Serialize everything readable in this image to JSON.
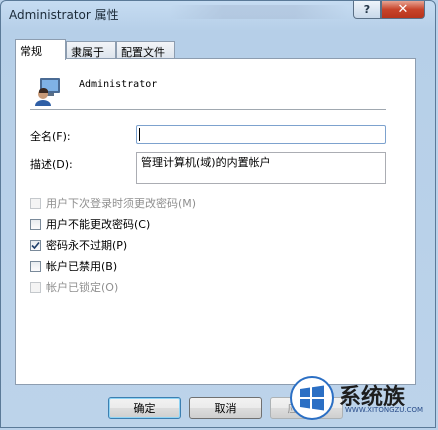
{
  "window": {
    "title": "Administrator 属性",
    "help_label": "?",
    "close_label": "✕"
  },
  "tabs": [
    {
      "label": "常规",
      "active": true
    },
    {
      "label": "隶属于",
      "active": false
    },
    {
      "label": "配置文件",
      "active": false
    }
  ],
  "user": {
    "name": "Administrator",
    "icon": "user-icon"
  },
  "fields": {
    "fullname_label": "全名(F):",
    "fullname_value": "",
    "description_label": "描述(D):",
    "description_value": "管理计算机(域)的内置帐户"
  },
  "options": [
    {
      "label": "用户下次登录时须更改密码(M)",
      "checked": false,
      "enabled": false
    },
    {
      "label": "用户不能更改密码(C)",
      "checked": false,
      "enabled": true
    },
    {
      "label": "密码永不过期(P)",
      "checked": true,
      "enabled": true
    },
    {
      "label": "帐户已禁用(B)",
      "checked": false,
      "enabled": true
    },
    {
      "label": "帐户已锁定(O)",
      "checked": false,
      "enabled": false
    }
  ],
  "buttons": {
    "ok": "确定",
    "cancel": "取消",
    "apply": "应用(A)"
  },
  "watermark": {
    "text": "系统族",
    "url": "WWW.XITONGZU.COM"
  },
  "colors": {
    "accent": "#3c7fb1",
    "close": "#c7432a"
  }
}
